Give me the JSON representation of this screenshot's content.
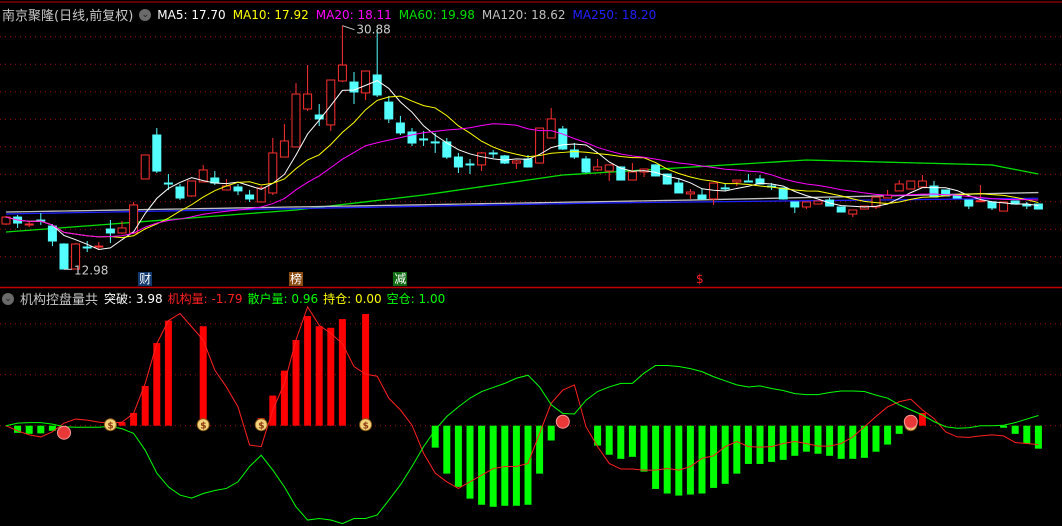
{
  "header": {
    "title": "南京聚隆(日线,前复权)",
    "ma": [
      {
        "label": "MA5: 17.70",
        "color": "#ffffff"
      },
      {
        "label": "MA10: 17.92",
        "color": "#ffff00"
      },
      {
        "label": "MA20: 18.11",
        "color": "#ff00ff"
      },
      {
        "label": "MA60: 19.98",
        "color": "#00e000"
      },
      {
        "label": "MA120: 18.62",
        "color": "#c0c0c0"
      },
      {
        "label": "MA250: 18.20",
        "color": "#2020ff"
      }
    ]
  },
  "indicator_header": {
    "title": "机构控盘量共",
    "items": [
      {
        "label": "突破: 3.98",
        "color": "#ffffff"
      },
      {
        "label": "机构量: -1.79",
        "color": "#ff2020"
      },
      {
        "label": "散户量: 0.96",
        "color": "#00ff00"
      },
      {
        "label": "持仓: 0.00",
        "color": "#ffff00"
      },
      {
        "label": "空仓: 1.00",
        "color": "#00ff00"
      }
    ]
  },
  "markers": [
    {
      "text": "财",
      "candle": 13,
      "bg": "#123a6e",
      "color": "#ffffff"
    },
    {
      "text": "榜",
      "candle": 26,
      "bg": "#8a4a10",
      "color": "#ffffff"
    },
    {
      "text": "减",
      "candle": 35,
      "bg": "#0e6a12",
      "color": "#ffffff"
    },
    {
      "text": "$",
      "candle": 61,
      "bg": "transparent",
      "color": "#ff2020"
    }
  ],
  "chart_data": [
    {
      "type": "candlestick",
      "title": "南京聚隆(日线,前复权)",
      "high_label": "30.88",
      "low_label": "12.98",
      "ylim": [
        12.5,
        31.5
      ],
      "up_color": "#ff3030",
      "down_color": "#54ffff",
      "ohlc": [
        [
          16.31,
          16.9,
          16.24,
          16.82
        ],
        [
          16.82,
          16.97,
          16.02,
          16.38
        ],
        [
          16.24,
          16.46,
          16.09,
          16.31
        ],
        [
          16.6,
          17.12,
          16.24,
          16.58
        ],
        [
          16.16,
          16.31,
          14.69,
          15.06
        ],
        [
          14.84,
          14.9,
          12.98,
          13.0
        ],
        [
          13.0,
          14.9,
          12.98,
          14.84
        ],
        [
          14.62,
          15.06,
          14.25,
          14.6
        ],
        [
          14.67,
          14.99,
          14.4,
          14.69
        ],
        [
          15.94,
          16.6,
          14.91,
          15.65
        ],
        [
          15.65,
          16.53,
          15.58,
          16.02
        ],
        [
          15.65,
          17.93,
          15.58,
          17.71
        ],
        [
          19.62,
          21.4,
          19.6,
          21.38
        ],
        [
          22.85,
          23.36,
          20.06,
          20.2
        ],
        [
          19.32,
          19.98,
          18.81,
          19.3
        ],
        [
          19.03,
          19.25,
          18.07,
          18.22
        ],
        [
          18.37,
          19.5,
          18.3,
          19.47
        ],
        [
          19.4,
          20.65,
          19.38,
          20.28
        ],
        [
          19.69,
          20.2,
          19.18,
          19.32
        ],
        [
          18.81,
          19.62,
          18.79,
          19.1
        ],
        [
          19.03,
          19.25,
          18.44,
          18.74
        ],
        [
          18.44,
          18.81,
          17.93,
          18.15
        ],
        [
          17.93,
          19.1,
          17.91,
          18.96
        ],
        [
          18.59,
          22.63,
          18.44,
          21.53
        ],
        [
          21.23,
          23.66,
          21.2,
          22.41
        ],
        [
          21.97,
          26.67,
          21.95,
          25.86
        ],
        [
          24.76,
          27.99,
          24.61,
          25.86
        ],
        [
          24.32,
          25.13,
          23.51,
          24.03
        ],
        [
          23.59,
          26.9,
          23.14,
          26.89
        ],
        [
          26.82,
          30.88,
          26.74,
          27.99
        ],
        [
          26.74,
          27.48,
          25.13,
          26.01
        ],
        [
          25.94,
          27.56,
          25.42,
          27.55
        ],
        [
          27.26,
          30.64,
          25.64,
          25.79
        ],
        [
          25.27,
          25.72,
          23.73,
          24.03
        ],
        [
          23.73,
          24.25,
          22.85,
          23.0
        ],
        [
          23.07,
          23.36,
          22.04,
          22.26
        ],
        [
          22.56,
          23.14,
          22.04,
          22.54
        ],
        [
          22.34,
          23.0,
          21.53,
          22.32
        ],
        [
          22.34,
          22.63,
          21.09,
          21.23
        ],
        [
          21.23,
          21.53,
          20.06,
          20.5
        ],
        [
          20.72,
          21.09,
          19.98,
          20.7
        ],
        [
          20.65,
          21.6,
          20.2,
          21.53
        ],
        [
          21.53,
          21.75,
          21.16,
          21.51
        ],
        [
          21.31,
          21.38,
          20.72,
          20.79
        ],
        [
          20.79,
          21.01,
          20.35,
          20.94
        ],
        [
          21.09,
          21.38,
          20.45,
          20.5
        ],
        [
          20.79,
          23.4,
          20.75,
          23.36
        ],
        [
          22.63,
          24.83,
          22.6,
          24.03
        ],
        [
          23.29,
          23.51,
          21.75,
          21.82
        ],
        [
          21.75,
          22.26,
          21.09,
          21.23
        ],
        [
          21.09,
          21.31,
          20.06,
          20.13
        ],
        [
          20.28,
          21.09,
          20.2,
          20.5
        ],
        [
          20.2,
          20.66,
          19.47,
          20.65
        ],
        [
          20.5,
          20.55,
          19.5,
          19.54
        ],
        [
          19.54,
          20.79,
          19.5,
          20.13
        ],
        [
          20.13,
          20.36,
          19.76,
          20.35
        ],
        [
          20.65,
          20.7,
          19.8,
          19.84
        ],
        [
          19.98,
          20.0,
          19.2,
          19.25
        ],
        [
          19.32,
          19.69,
          18.55,
          18.59
        ],
        [
          18.52,
          18.88,
          18.15,
          18.66
        ],
        [
          18.44,
          18.88,
          18.1,
          18.15
        ],
        [
          18.15,
          19.35,
          17.71,
          19.32
        ],
        [
          18.96,
          19.25,
          18.74,
          18.94
        ],
        [
          19.4,
          19.55,
          19.1,
          19.54
        ],
        [
          19.47,
          19.98,
          19.4,
          19.45
        ],
        [
          19.62,
          19.91,
          19.2,
          19.25
        ],
        [
          19.1,
          19.32,
          18.81,
          19.08
        ],
        [
          18.96,
          19.0,
          18.1,
          18.15
        ],
        [
          17.93,
          17.95,
          17.12,
          17.56
        ],
        [
          17.56,
          17.95,
          17.41,
          17.93
        ],
        [
          17.78,
          18.02,
          17.76,
          18.0
        ],
        [
          18.07,
          18.22,
          17.6,
          17.63
        ],
        [
          17.56,
          17.58,
          17.17,
          17.19
        ],
        [
          17.04,
          17.36,
          16.82,
          17.34
        ],
        [
          17.41,
          17.65,
          17.39,
          17.63
        ],
        [
          17.56,
          18.31,
          17.41,
          18.29
        ],
        [
          18.22,
          18.81,
          18.2,
          18.44
        ],
        [
          18.74,
          19.54,
          18.72,
          19.25
        ],
        [
          18.88,
          19.49,
          18.86,
          19.47
        ],
        [
          19.03,
          19.91,
          19.0,
          19.47
        ],
        [
          19.1,
          19.47,
          18.27,
          18.29
        ],
        [
          18.81,
          18.83,
          18.35,
          18.37
        ],
        [
          18.44,
          18.46,
          18.2,
          18.22
        ],
        [
          18.07,
          18.09,
          17.41,
          17.63
        ],
        [
          18.0,
          19.18,
          17.93,
          18.02
        ],
        [
          17.93,
          17.95,
          17.34,
          17.49
        ],
        [
          17.26,
          17.95,
          17.24,
          17.93
        ],
        [
          18.0,
          18.02,
          17.76,
          17.78
        ],
        [
          17.71,
          17.93,
          17.41,
          17.7
        ],
        [
          17.78,
          17.8,
          17.39,
          17.41
        ]
      ],
      "computed_ma": [
        {
          "name": "MA5",
          "period": 5,
          "color": "#ffffff"
        },
        {
          "name": "MA10",
          "period": 10,
          "color": "#ffff00"
        },
        {
          "name": "MA20",
          "period": 20,
          "color": "#ff00ff"
        }
      ],
      "long_ma": [
        {
          "name": "MA60",
          "color": "#00e000",
          "points": [
            [
              1,
              15.72
            ],
            [
              26,
              17.34
            ],
            [
              37,
              18.44
            ],
            [
              49,
              19.91
            ],
            [
              70,
              21.01
            ],
            [
              86,
              20.65
            ],
            [
              90,
              19.98
            ]
          ]
        },
        {
          "name": "MA120",
          "color": "#c0c0c0",
          "points": [
            [
              1,
              17.19
            ],
            [
              60,
              18.07
            ],
            [
              90,
              18.62
            ]
          ]
        },
        {
          "name": "MA250",
          "color": "#2020ff",
          "points": [
            [
              1,
              17.05
            ],
            [
              52,
              17.85
            ],
            [
              90,
              18.2
            ]
          ]
        }
      ]
    },
    {
      "type": "bar",
      "title": "机构控盘量共",
      "ylim": [
        -10,
        12
      ],
      "gridlines": [
        0,
        5,
        10
      ],
      "bars": [
        0,
        -0.7,
        -0.8,
        -0.75,
        -0.5,
        0,
        0,
        0,
        0,
        0,
        0.35,
        1.25,
        3.9,
        8.1,
        10.3,
        0,
        0,
        9.75,
        0,
        0,
        0,
        0,
        0.75,
        2.95,
        5.4,
        8.4,
        10.75,
        9.75,
        9.6,
        10.45,
        0,
        10.95,
        0,
        0,
        0,
        0,
        0,
        -2.15,
        -4.7,
        -6.0,
        -7.15,
        -7.75,
        -7.95,
        -7.85,
        -7.85,
        -7.75,
        -4.7,
        -1.45,
        0,
        0,
        0,
        -1.95,
        -2.85,
        -3.25,
        -3.05,
        -4.5,
        -6.2,
        -6.65,
        -6.85,
        -6.75,
        -6.65,
        -6.1,
        -5.7,
        -4.7,
        -3.75,
        -3.75,
        -3.55,
        -3.35,
        -2.95,
        -2.55,
        -2.75,
        -2.95,
        -3.25,
        -3.25,
        -3.15,
        -2.55,
        -1.85,
        -0.8,
        0,
        1.25,
        0,
        0,
        0,
        0,
        0,
        0,
        -0.2,
        -0.8,
        -1.75,
        -2.25
      ],
      "series": [
        {
          "name": "机构量",
          "color": "#ff2020",
          "values": [
            0,
            -0.5,
            -0.9,
            -1.1,
            -0.6,
            0.25,
            0.65,
            0.55,
            0.35,
            0.25,
            0.35,
            1.2,
            4.15,
            8.05,
            10.3,
            11,
            9.7,
            8.4,
            5.45,
            3.8,
            1.85,
            -1.9,
            -2.05,
            1.55,
            4.15,
            8.4,
            11.65,
            9.85,
            9.05,
            8.05,
            5.8,
            5.05,
            4.85,
            2.7,
            1.55,
            0.05,
            -2.7,
            -4.65,
            -5.5,
            -6.15,
            -5.5,
            -4.85,
            -4.2,
            -4,
            -4,
            -3.7,
            -0.75,
            2.2,
            3.5,
            4,
            -0.1,
            -2.05,
            -3.7,
            -4.25,
            -4.25,
            -4.35,
            -4.35,
            -4.2,
            -4.35,
            -4,
            -3.2,
            -2.95,
            -2.05,
            -1.55,
            -2.05,
            -2.1,
            -2.05,
            -1.75,
            -1.55,
            -1.75,
            -2,
            -2,
            -1.75,
            -1.1,
            -0.1,
            0.9,
            1.85,
            2.35,
            2.6,
            1.55,
            0.7,
            -0.6,
            -1.1,
            -1.15,
            -1,
            -0.9,
            -1,
            -1.65,
            -1.75,
            -1.85
          ]
        },
        {
          "name": "散户量",
          "color": "#00ff00",
          "values": [
            0,
            0.25,
            0.3,
            0.3,
            0.15,
            -0.1,
            -0.15,
            -0.15,
            -0.15,
            -0.05,
            -0.3,
            -0.75,
            -2.4,
            -4.65,
            -6,
            -6.8,
            -7.1,
            -6.65,
            -6.35,
            -6.15,
            -5.5,
            -4,
            -2.9,
            -4.35,
            -6,
            -7.95,
            -9.25,
            -9.1,
            -9.25,
            -9.6,
            -9.1,
            -9.1,
            -8.75,
            -7.3,
            -5.8,
            -4,
            -2.05,
            -0.4,
            0.9,
            1.85,
            2.7,
            3.35,
            3.75,
            4.15,
            4.65,
            4.95,
            3.8,
            2.05,
            1.2,
            1.15,
            2.5,
            3.35,
            3.8,
            4.15,
            4.15,
            5.15,
            5.9,
            5.9,
            5.8,
            5.6,
            5.3,
            4.8,
            4.4,
            4,
            3.8,
            3.9,
            3.65,
            3.45,
            3.15,
            3.05,
            3.05,
            3.25,
            3.4,
            3.4,
            3.35,
            3,
            2.7,
            2.05,
            1.55,
            1.05,
            0.4,
            -0.1,
            -0.25,
            -0.2,
            0,
            0,
            0.05,
            0.3,
            0.65,
            1.0
          ]
        }
      ],
      "ball_signals": [
        6,
        49,
        79
      ],
      "bag_signals": [
        10,
        18,
        23,
        32,
        79
      ]
    }
  ]
}
